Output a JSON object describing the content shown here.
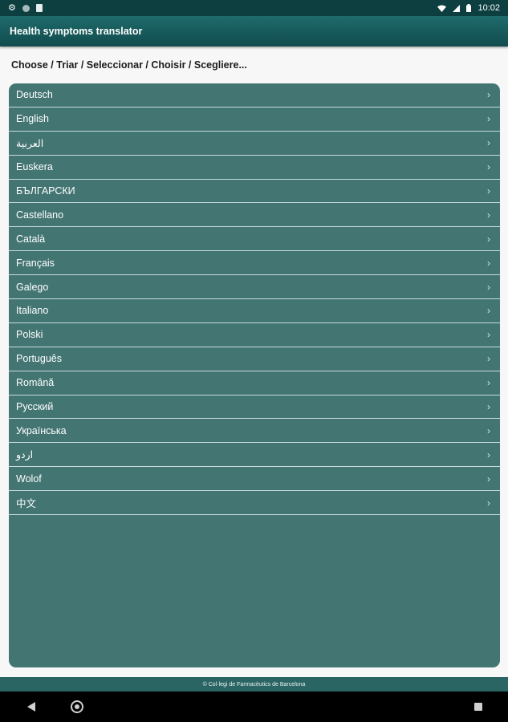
{
  "status_bar": {
    "time": "10:02",
    "left_icons": [
      "gear-icon",
      "circle-icon",
      "document-icon"
    ],
    "right_icons": [
      "wifi-icon",
      "signal-icon",
      "battery-icon"
    ]
  },
  "app_bar": {
    "title": "Health symptoms translator"
  },
  "prompt": "Choose / Triar / Seleccionar / Choisir / Scegliere...",
  "languages": [
    "Deutsch",
    "English",
    "العربية",
    "Euskera",
    "БЪЛГАРСКИ",
    "Castellano",
    "Català",
    "Français",
    "Galego",
    "Italiano",
    "Polski",
    "Português",
    "Română",
    "Русский",
    "Українська",
    "اردو",
    "Wolof",
    "中文"
  ],
  "row_chevron": "›",
  "footer": "© Col·legi de Farmacèutics de Barcelona",
  "colors": {
    "app_bar": "#124c4e",
    "panel": "#437572",
    "divider": "#c9dcda"
  }
}
